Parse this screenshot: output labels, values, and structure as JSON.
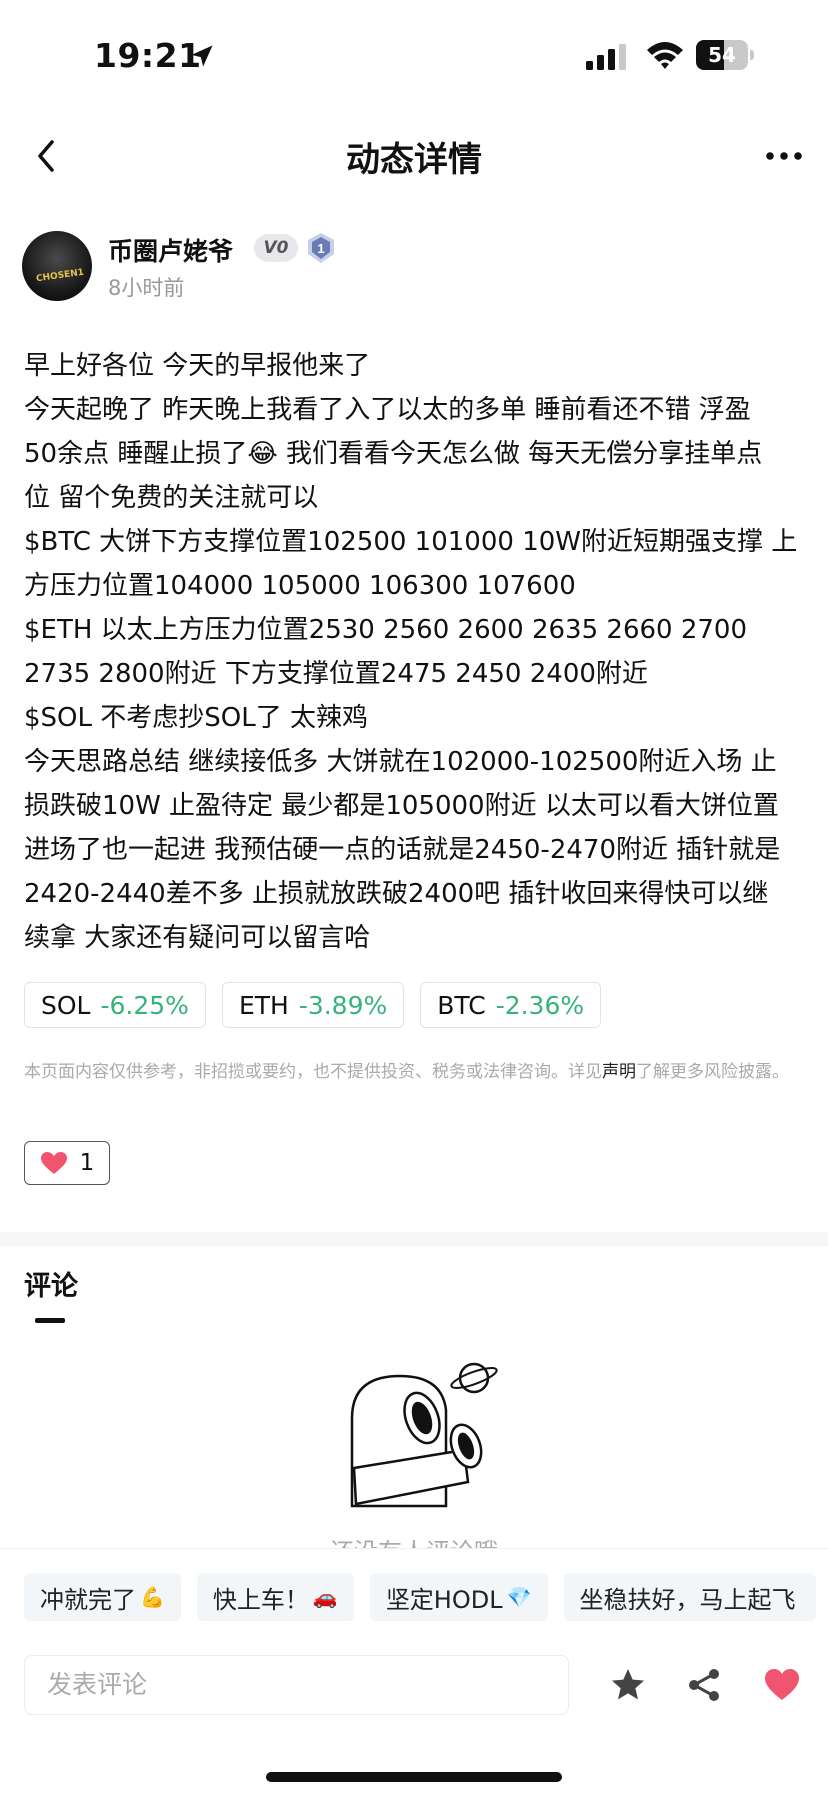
{
  "status_bar": {
    "time": "19:21",
    "battery": "54",
    "battery_level": 0.54
  },
  "nav": {
    "title": "动态详情"
  },
  "author": {
    "name": "币圈卢姥爷",
    "badge_v": "V0",
    "badge_level": "1",
    "time_ago": "8小时前",
    "avatar_text": "CHOSEN1"
  },
  "post": {
    "lines": [
      "早上好各位 今天的早报他来了",
      "今天起晚了 昨天晚上我看了入了以太的多单 睡前看还不错 浮盈",
      "50余点 睡醒止损了😂 我们看看今天怎么做 每天无偿分享挂单点",
      "位 留个免费的关注就可以",
      "$BTC 大饼下方支撑位置102500 101000 10W附近短期强支撑 上",
      "方压力位置104000 105000 106300 107600",
      "$ETH 以太上方压力位置2530 2560 2600 2635 2660 2700",
      "2735 2800附近 下方支撑位置2475 2450 2400附近",
      "$SOL 不考虑抄SOL了 太辣鸡",
      "今天思路总结 继续接低多 大饼就在102000-102500附近入场 止",
      "损跌破10W 止盈待定 最少都是105000附近 以太可以看大饼位置",
      "进场了也一起进 我预估硬一点的话就是2450-2470附近 插针就是",
      "2420-2440差不多 止损就放跌破2400吧 插针收回来得快可以继",
      "续拿 大家还有疑问可以留言哈"
    ]
  },
  "coins": [
    {
      "symbol": "SOL",
      "change": "-6.25%"
    },
    {
      "symbol": "ETH",
      "change": "-3.89%"
    },
    {
      "symbol": "BTC",
      "change": "-2.36%"
    }
  ],
  "disclaimer": {
    "before": "本页面内容仅供参考，非招揽或要约，也不提供投资、税务或法律咨询。详见",
    "link": "声明",
    "after": "了解更多风险披露。"
  },
  "like": {
    "count": "1",
    "color": "#f0546e"
  },
  "comments": {
    "title": "评论",
    "empty_text": "还没有人评论哦"
  },
  "quick_replies": [
    {
      "text": "冲就完了",
      "emoji": "💪"
    },
    {
      "text": "快上车！",
      "emoji": "🚗"
    },
    {
      "text": "坚定HODL",
      "emoji": "💎"
    },
    {
      "text": "坐稳扶好，马上起飞",
      "emoji": ""
    }
  ],
  "input": {
    "placeholder": "发表评论"
  },
  "colors": {
    "accent_green": "#37b27a",
    "heart": "#f0546e"
  }
}
